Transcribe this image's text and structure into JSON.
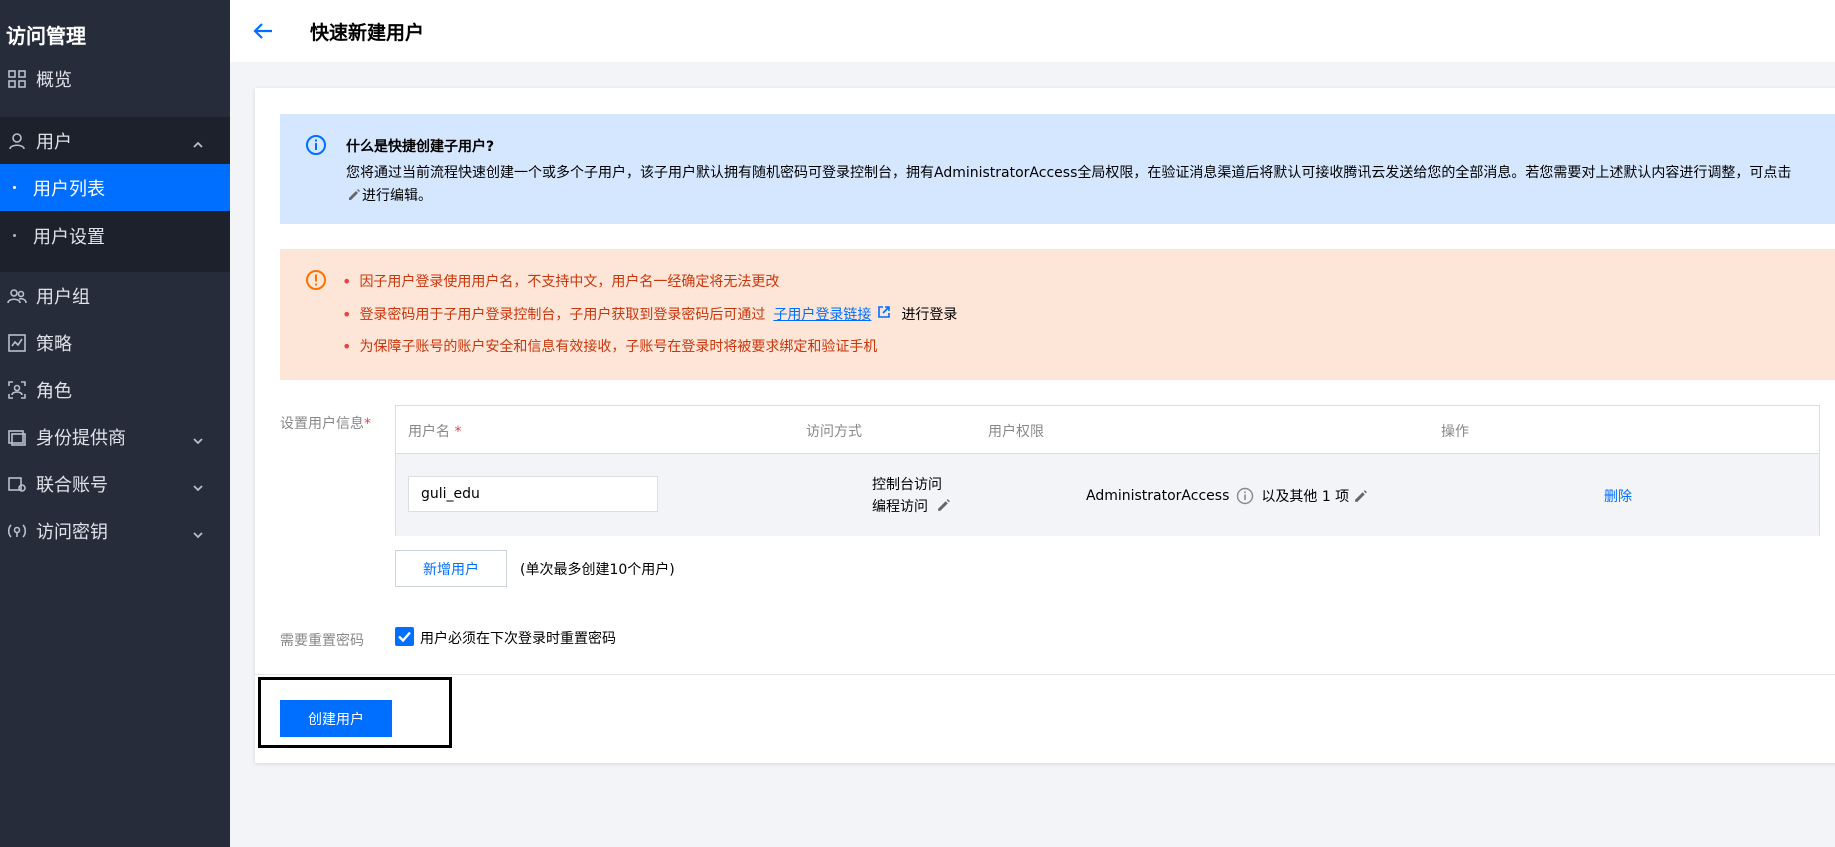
{
  "sidebar": {
    "title": "访问管理",
    "items": {
      "overview": "概览",
      "users": "用户",
      "user_list": "用户列表",
      "user_settings": "用户设置",
      "user_groups": "用户组",
      "policies": "策略",
      "roles": "角色",
      "identity_providers": "身份提供商",
      "federated_accounts": "联合账号",
      "access_keys": "访问密钥"
    }
  },
  "header": {
    "title": "快速新建用户"
  },
  "info": {
    "title": "什么是快捷创建子用户?",
    "text_part1": "您将通过当前流程快速创建一个或多个子用户，该子用户默认拥有随机密码可登录控制台，拥有AdministratorAccess全局权限，在验证消息渠道后将默认可接收腾讯云发送给您的全部消息。若您需要对上述默认内容进行调整，可点击",
    "text_part2": "进行编辑。"
  },
  "warnings": {
    "item1": "因子用户登录使用用户名，不支持中文，用户名一经确定将无法更改",
    "item2_before": "登录密码用于子用户登录控制台，子用户获取到登录密码后可通过",
    "item2_link": "子用户登录链接",
    "item2_after": "进行登录",
    "item3": "为保障子账号的账户安全和信息有效接收，子账号在登录时将被要求绑定和验证手机"
  },
  "form": {
    "user_info_label": "设置用户信息",
    "required_mark": "*",
    "table": {
      "headers": {
        "username": "用户名",
        "access_method": "访问方式",
        "permissions": "用户权限",
        "actions": "操作"
      },
      "row": {
        "username_value": "guli_edu",
        "access_console": "控制台访问",
        "access_programmatic": "编程访问",
        "permission_name": "AdministratorAccess",
        "permission_more": "以及其他 1 项",
        "delete_label": "删除"
      }
    },
    "add_user_label": "新增用户",
    "add_user_note": "(单次最多创建10个用户)",
    "reset_password_label": "需要重置密码",
    "reset_password_checkbox": "用户必须在下次登录时重置密码",
    "create_button": "创建用户"
  },
  "colors": {
    "accent": "#006eff",
    "sidebar_bg": "#262c3a",
    "info_bg": "#d5e7fe",
    "warn_bg": "#fde6d7",
    "warn_text": "#c9360c"
  }
}
